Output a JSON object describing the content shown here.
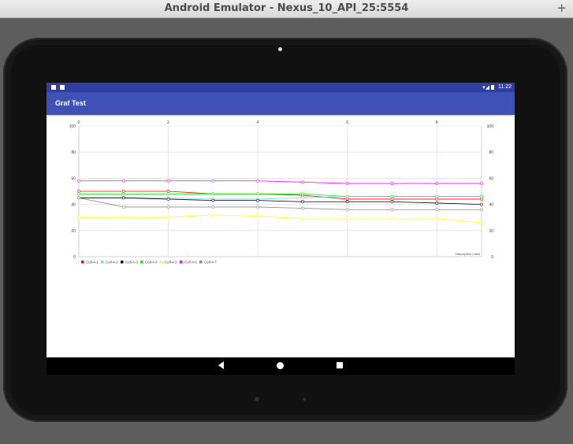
{
  "window": {
    "title": "Android Emulator - Nexus_10_API_25:5554",
    "plus_label": "+"
  },
  "status_bar": {
    "time": "11:22"
  },
  "app_bar": {
    "title": "Graf Test"
  },
  "chart_data": {
    "type": "line",
    "x": [
      0,
      1,
      2,
      3,
      4,
      5,
      6,
      7,
      8,
      9
    ],
    "xticks": [
      "0",
      "2",
      "4",
      "6",
      "8"
    ],
    "xtick_values": [
      0,
      2,
      4,
      6,
      8
    ],
    "ylim": [
      0,
      100
    ],
    "yticks": [
      "0",
      "20",
      "40",
      "60",
      "80",
      "100"
    ],
    "ytick_values": [
      0,
      20,
      40,
      60,
      80,
      100
    ],
    "description_label": "Description Label",
    "grid": true,
    "legend_position": "bottom-left",
    "series": [
      {
        "name": "Cell-4-1",
        "color": "#ff0000",
        "values": [
          50,
          50,
          50,
          48,
          48,
          47,
          44,
          44,
          44,
          44
        ]
      },
      {
        "name": "Cell-4-2",
        "color": "#7fd3ff",
        "values": [
          45,
          45,
          45,
          44,
          44,
          45,
          46,
          46,
          46,
          46
        ]
      },
      {
        "name": "Cell-4-3",
        "color": "#000000",
        "values": [
          45,
          45,
          44,
          43,
          43,
          42,
          42,
          42,
          41,
          40
        ]
      },
      {
        "name": "Cell-4-4",
        "color": "#00ff00",
        "values": [
          48,
          48,
          48,
          48,
          48,
          48,
          46,
          46,
          46,
          46
        ]
      },
      {
        "name": "Cell-4-5",
        "color": "#ffff00",
        "values": [
          30,
          30,
          30,
          32,
          31,
          29,
          29,
          29,
          29,
          26
        ]
      },
      {
        "name": "Cell-4-6",
        "color": "#ff00ff",
        "values": [
          58,
          58,
          58,
          58,
          58,
          57,
          56,
          56,
          56,
          56
        ]
      },
      {
        "name": "Cell-4-7",
        "color": "#888888",
        "values": [
          45,
          38,
          38,
          38,
          38,
          37,
          36,
          36,
          36,
          36
        ]
      }
    ]
  }
}
